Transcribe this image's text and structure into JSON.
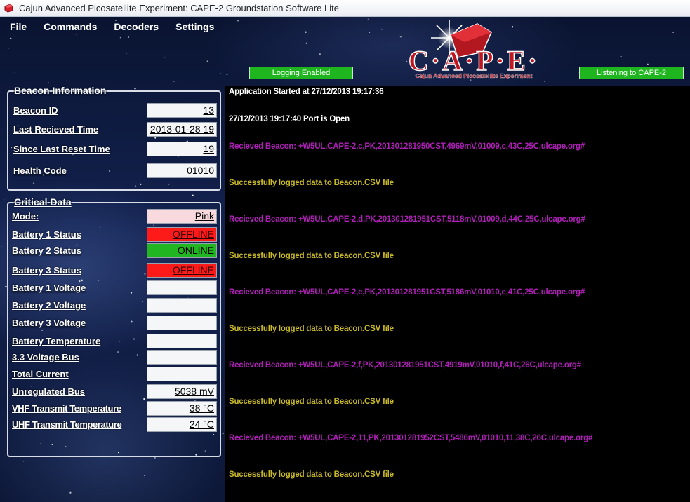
{
  "window": {
    "title": "Cajun Advanced Picosatellite Experiment: CAPE-2 Groundstation Software Lite",
    "app_icon": "cape-app-icon"
  },
  "menu": [
    "File",
    "Commands",
    "Decoders",
    "Settings"
  ],
  "logo": {
    "text": "C·A·P·E·",
    "subtitle": "Cajun Advanced Picosatellite Experiment"
  },
  "status": {
    "logging": "Logging Enabled",
    "listening": "Listening to CAPE-2"
  },
  "beacon_info": {
    "title": "Beacon Information",
    "fields": [
      {
        "label": "Beacon ID",
        "value": "13"
      },
      {
        "label": "Last Recieved Time",
        "value": "2013-01-28 19"
      },
      {
        "label": "Since Last Reset Time",
        "value": "19"
      },
      {
        "label": "Health Code",
        "value": "01010"
      }
    ]
  },
  "critical_data": {
    "title": "Critical Data",
    "fields": [
      {
        "label": "Mode:",
        "value": "Pink",
        "state": "pink"
      },
      {
        "label": "Battery 1 Status",
        "value": "OFFLINE",
        "state": "red"
      },
      {
        "label": "Battery 2 Status",
        "value": "ONLINE",
        "state": "green"
      },
      {
        "label": "Battery 3 Status",
        "value": "OFFLINE",
        "state": "red"
      },
      {
        "label": "Battery 1 Voltage",
        "value": ""
      },
      {
        "label": "Battery 2 Voltage",
        "value": ""
      },
      {
        "label": "Battery 3 Voltage",
        "value": ""
      },
      {
        "label": "Battery Temperature",
        "value": ""
      },
      {
        "label": "3.3 Voltage Bus",
        "value": ""
      },
      {
        "label": "Total Current",
        "value": ""
      },
      {
        "label": "Unregulated Bus",
        "value": "5038 mV"
      },
      {
        "label": "VHF Transmit Temperature",
        "value": "38 °C"
      },
      {
        "label": "UHF Transmit Temperature",
        "value": "24 °C"
      }
    ]
  },
  "log": [
    {
      "text": "Application Started at 27/12/2013 19:17:36",
      "color": "#ffffff"
    },
    {
      "text": "27/12/2013 19:17:40 Port is Open",
      "color": "#ffffff"
    },
    {
      "text": "Recieved Beacon: +W5UL,CAPE-2,c,PK,201301281950CST,4969mV,01009,c,43C,25C,ulcape.org#",
      "color": "#b01fb8"
    },
    {
      "text": "Successfully logged data to Beacon.CSV file",
      "color": "#c9b92a"
    },
    {
      "text": "Recieved Beacon: +W5UL,CAPE-2,d,PK,201301281951CST,5118mV,01009,d,44C,25C,ulcape.org#",
      "color": "#b01fb8"
    },
    {
      "text": "Successfully logged data to Beacon.CSV file",
      "color": "#c9b92a"
    },
    {
      "text": "Recieved Beacon: +W5UL,CAPE-2,e,PK,201301281951CST,5186mV,01010,e,41C,25C,ulcape.org#",
      "color": "#b01fb8"
    },
    {
      "text": "Successfully logged data to Beacon.CSV file",
      "color": "#c9b92a"
    },
    {
      "text": "Recieved Beacon: +W5UL,CAPE-2,f,PK,201301281951CST,4919mV,01010,f,41C,26C,ulcape.org#",
      "color": "#b01fb8"
    },
    {
      "text": "Successfully logged data to Beacon.CSV file",
      "color": "#c9b92a"
    },
    {
      "text": "Recieved Beacon: +W5UL,CAPE-2,11,PK,201301281952CST,5486mV,01010,11,38C,26C,ulcape.org#",
      "color": "#b01fb8"
    },
    {
      "text": "Successfully logged data to Beacon.CSV file",
      "color": "#c9b92a"
    }
  ]
}
